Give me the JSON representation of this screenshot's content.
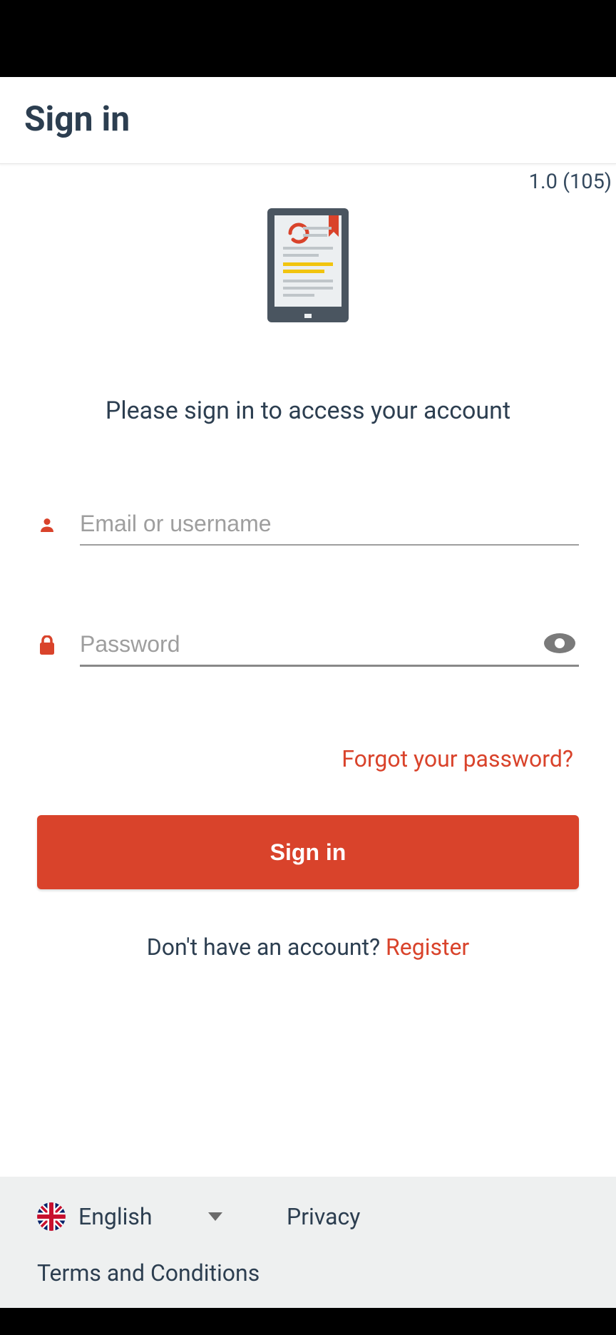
{
  "header": {
    "title": "Sign in"
  },
  "version": "1.0 (105)",
  "prompt": "Please sign in to access your account",
  "fields": {
    "email_placeholder": "Email or username",
    "email_value": "",
    "password_placeholder": "Password",
    "password_value": ""
  },
  "links": {
    "forgot": "Forgot your password?",
    "register_prefix": "Don't have an account? ",
    "register": "Register"
  },
  "buttons": {
    "signin": "Sign in"
  },
  "footer": {
    "language": "English",
    "privacy": "Privacy",
    "terms": "Terms and Conditions"
  },
  "icons": {
    "person": "person-icon",
    "lock": "lock-icon",
    "eye": "eye-icon",
    "caret": "chevron-down-icon",
    "flag": "uk-flag-icon",
    "logo": "tablet-document-icon"
  },
  "colors": {
    "accent": "#d9432b",
    "heading": "#2c3e50"
  }
}
